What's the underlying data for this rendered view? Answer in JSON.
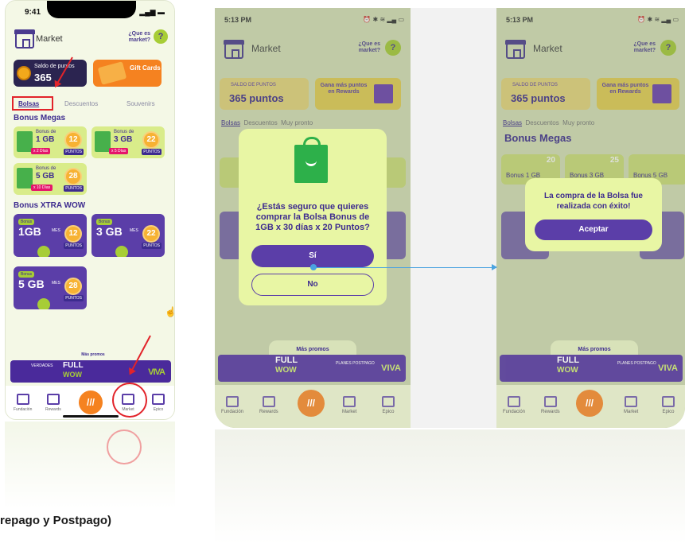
{
  "footer_caption": "repago y Postpago)",
  "phone1": {
    "time": "9:41",
    "title": "Market",
    "help": "¿Que es market?",
    "help_btn": "?",
    "points_label": "Saldo de puntos",
    "points_value": "365",
    "gift_label": "Gift Cards",
    "tabs": [
      "Bolsas",
      "Descuentos",
      "Souvenirs"
    ],
    "section_megas": "Bonus Megas",
    "megas": [
      {
        "prefix": "Bonus de",
        "gb": "1 GB",
        "days": "x 2 Días",
        "coin": "12",
        "pts": "PUNTOS"
      },
      {
        "prefix": "Bonus de",
        "gb": "3 GB",
        "days": "x 5 Días",
        "coin": "22",
        "pts": "PUNTOS"
      },
      {
        "prefix": "Bonus de",
        "gb": "5 GB",
        "days": "x 10 Días",
        "coin": "28",
        "pts": "PUNTOS"
      }
    ],
    "section_xtra": "Bonus XTRA WOW",
    "xtra": [
      {
        "tag": "Bonus",
        "gb": "1GB",
        "mes": "MES",
        "coin": "12",
        "pts": "PUNTOS"
      },
      {
        "tag": "Bonus",
        "gb": "3 GB",
        "mes": "MES",
        "coin": "22",
        "pts": "PUNTOS"
      },
      {
        "tag": "Bonus",
        "gb": "5 GB",
        "mes": "MES",
        "coin": "28",
        "pts": "PUNTOS"
      }
    ],
    "mas_promos": "Más promos",
    "banner": {
      "verdades": "VERDADES",
      "full": "FULL",
      "wow": "WOW",
      "brand": "VIVA"
    },
    "nav": [
      "Fundación",
      "Rewards",
      "Market",
      "Epico"
    ],
    "center": "///"
  },
  "phone2": {
    "time": "5:13 PM",
    "title": "Market",
    "help": "¿Que es market?",
    "help_btn": "?",
    "points_label": "SALDO DE PUNTOS",
    "points_value": "365 puntos",
    "rewards_label": "Gana más puntos en Rewards",
    "tabs": [
      "Bolsas",
      "Descuentos",
      "Muy pronto"
    ],
    "section": "Bonus Megas",
    "modal_text": "¿Estás seguro que quieres comprar la Bolsa Bonus de 1GB x 30 días x 20 Puntos?",
    "btn_yes": "Sí",
    "btn_no": "No",
    "mas_promos": "Más promos",
    "banner": {
      "full": "FULL",
      "wow": "WOW",
      "planes": "PLANES POSTPAGO",
      "brand": "VIVA"
    },
    "nav": [
      "Fundación",
      "Rewards",
      "Market",
      "Epico"
    ],
    "center": "///"
  },
  "phone3": {
    "time": "5:13 PM",
    "title": "Market",
    "help": "¿Que es market?",
    "help_btn": "?",
    "points_label": "SALDO DE PUNTOS",
    "points_value": "365 puntos",
    "rewards_label": "Gana más puntos en Rewards",
    "tabs": [
      "Bolsas",
      "Descuentos",
      "Muy pronto"
    ],
    "section": "Bonus Megas",
    "bg_labels": [
      "Bonus 1 GB",
      "Bonus 3 GB",
      "Bonus 5 GB"
    ],
    "bg_coins": [
      "20",
      "25"
    ],
    "modal_text": "La compra de la Bolsa fue realizada con éxito!",
    "btn_ok": "Aceptar",
    "mas_promos": "Más promos",
    "banner": {
      "full": "FULL",
      "wow": "WOW",
      "planes": "PLANES POSTPAGO",
      "brand": "VIVA"
    },
    "nav": [
      "Fundación",
      "Rewards",
      "Market",
      "Epico"
    ],
    "center": "///"
  }
}
